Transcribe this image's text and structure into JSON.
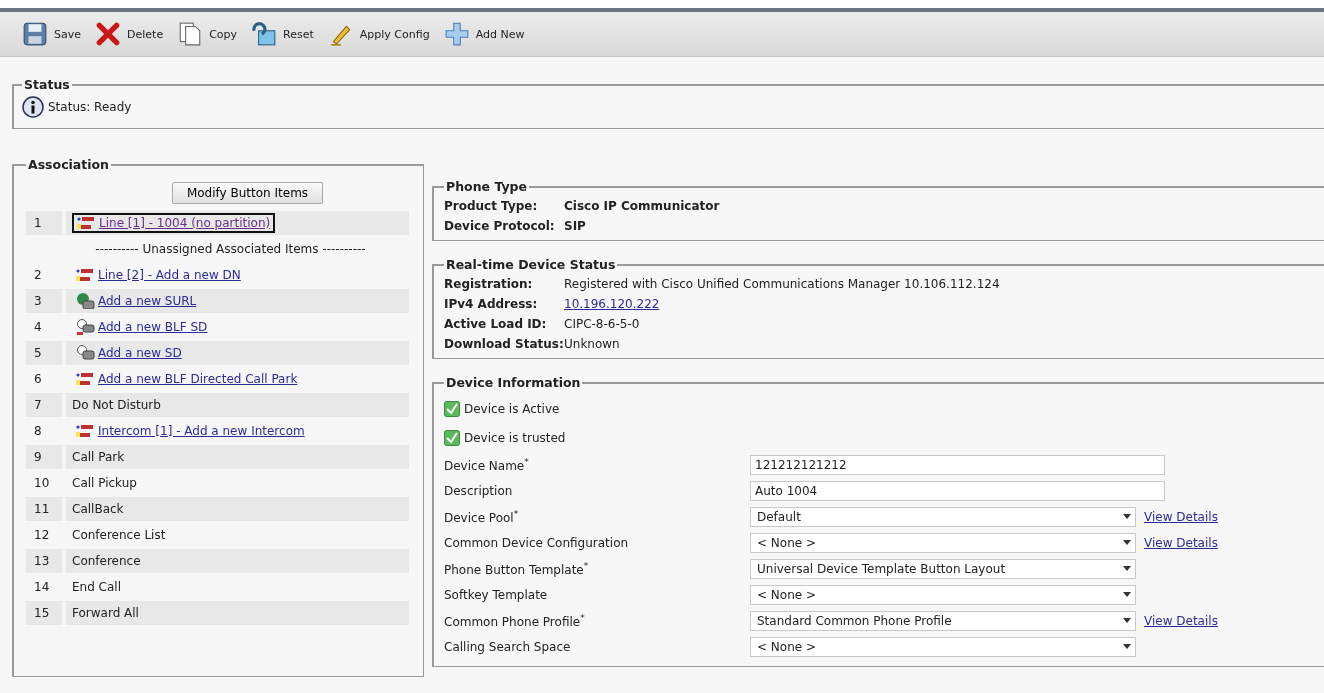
{
  "toolbar": [
    {
      "kind": "save",
      "label": "Save"
    },
    {
      "kind": "delete",
      "label": "Delete"
    },
    {
      "kind": "copy",
      "label": "Copy"
    },
    {
      "kind": "reset",
      "label": "Reset"
    },
    {
      "kind": "apply",
      "label": "Apply Config"
    },
    {
      "kind": "add",
      "label": "Add New"
    }
  ],
  "status": {
    "legend": "Status",
    "text": "Status: Ready"
  },
  "association": {
    "legend": "Association",
    "button": "Modify Button Items",
    "items": [
      {
        "number": "1",
        "kind": "line",
        "label": "Line [1] - 1004 (no partition)",
        "highlighted": true
      },
      {
        "kind": "separator",
        "label": "---------- Unassigned Associated Items ----------"
      },
      {
        "number": "2",
        "kind": "line",
        "label": "Line [2] - Add a new DN",
        "highlighted": false
      },
      {
        "number": "3",
        "kind": "surl",
        "label": "Add a new SURL",
        "highlighted": false
      },
      {
        "number": "4",
        "kind": "blf",
        "label": "Add a new BLF SD",
        "highlighted": false
      },
      {
        "number": "5",
        "kind": "sd",
        "label": "Add a new SD",
        "highlighted": false
      },
      {
        "number": "6",
        "kind": "line",
        "label": "Add a new BLF Directed Call Park",
        "highlighted": false
      },
      {
        "number": "7",
        "kind": "text",
        "label": "Do Not Disturb"
      },
      {
        "number": "8",
        "kind": "line",
        "label": "Intercom [1] - Add a new Intercom",
        "highlighted": false
      },
      {
        "number": "9",
        "kind": "text",
        "label": "Call Park"
      },
      {
        "number": "10",
        "kind": "text",
        "label": "Call Pickup"
      },
      {
        "number": "11",
        "kind": "text",
        "label": "CallBack"
      },
      {
        "number": "12",
        "kind": "text",
        "label": "Conference List"
      },
      {
        "number": "13",
        "kind": "text",
        "label": "Conference"
      },
      {
        "number": "14",
        "kind": "text",
        "label": "End Call"
      },
      {
        "number": "15",
        "kind": "text",
        "label": "Forward All"
      }
    ]
  },
  "phone_type": {
    "legend": "Phone Type",
    "fields": [
      {
        "label": "Product Type:",
        "value": "Cisco IP Communicator"
      },
      {
        "label": "Device Protocol:",
        "value": "SIP"
      }
    ]
  },
  "realtime_status": {
    "legend": "Real-time Device Status",
    "fields": [
      {
        "label": "Registration:",
        "value": "Registered with Cisco Unified Communications Manager 10.106.112.124",
        "kind": "text"
      },
      {
        "label": "IPv4 Address:",
        "value": "10.196.120.222",
        "kind": "link"
      },
      {
        "label": "Active Load ID:",
        "value": "CIPC-8-6-5-0",
        "kind": "text"
      },
      {
        "label": "Download Status:",
        "value": "Unknown",
        "kind": "text"
      }
    ]
  },
  "device_information": {
    "legend": "Device Information",
    "checkboxes": [
      {
        "label": "Device is Active",
        "checked": true
      },
      {
        "label": "Device is trusted",
        "checked": true
      }
    ],
    "fields": [
      {
        "label": "Device Name$^{*}$",
        "kind": "input",
        "value": "121212121212"
      },
      {
        "label": "Description",
        "kind": "input",
        "value": "Auto 1004"
      },
      {
        "label": "Device Pool$^{*}$",
        "kind": "select",
        "value": "Default",
        "link": "View Details"
      },
      {
        "label": "Common Device Configuration",
        "kind": "select",
        "value": "< None >",
        "link": "View Details"
      },
      {
        "label": "Phone Button Template$^{*}$",
        "kind": "select",
        "value": "Universal Device Template Button Layout"
      },
      {
        "label": "Softkey Template",
        "kind": "select",
        "value": "< None >"
      },
      {
        "label": "Common Phone Profile$^{*}$",
        "kind": "select",
        "value": "Standard Common Phone Profile",
        "link": "View Details"
      },
      {
        "label": "Calling Search Space",
        "kind": "select",
        "value": "< None >"
      }
    ]
  }
}
